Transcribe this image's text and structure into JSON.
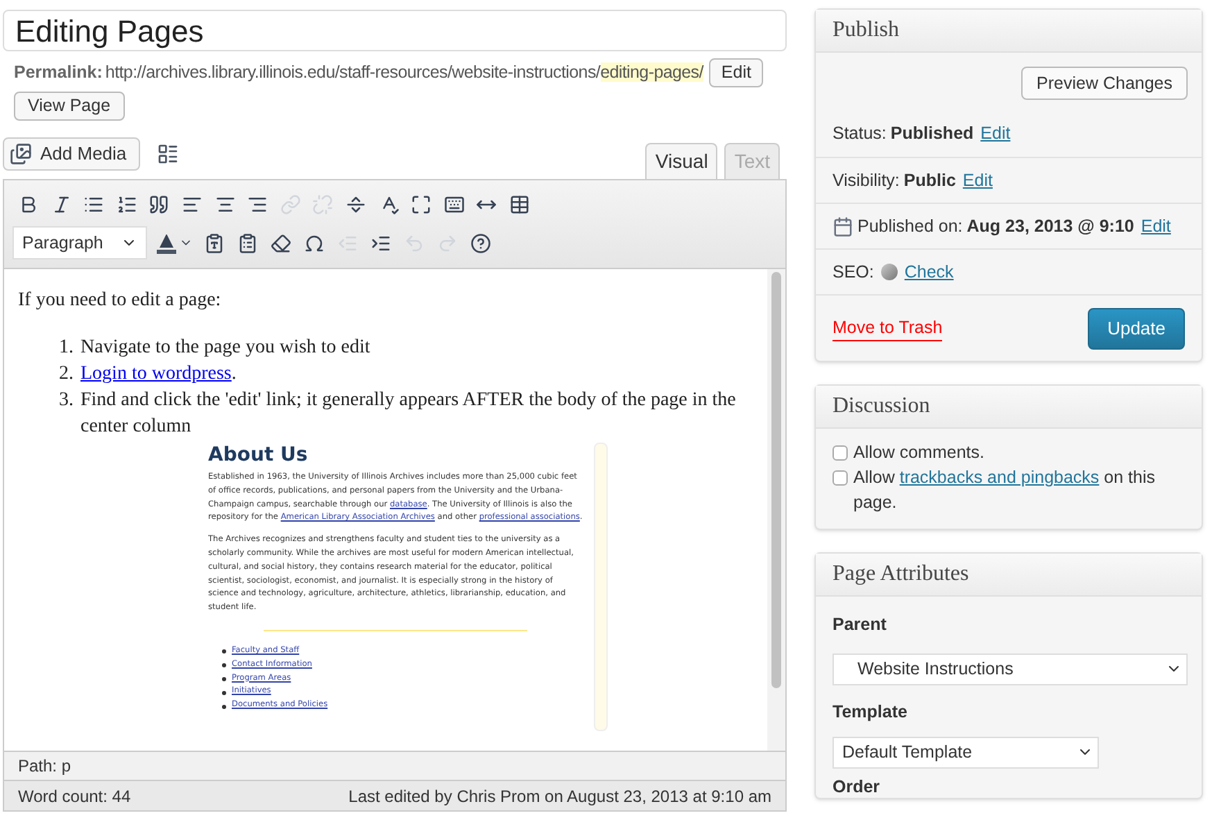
{
  "title_field": {
    "value": "Editing Pages"
  },
  "permalink": {
    "label": "Permalink:",
    "base": "http://archives.library.illinois.edu/staff-resources/website-instructions/",
    "slug": "editing-pages/",
    "edit_button": "Edit",
    "view_button": "View Page"
  },
  "media_button": "Add Media",
  "editor_tabs": [
    {
      "label": "Visual",
      "selected": true
    },
    {
      "label": "Text",
      "selected": false
    }
  ],
  "toolbar": {
    "row_1": [
      {
        "disabled": false
      },
      {
        "disabled": false
      },
      {
        "disabled": false
      },
      {
        "disabled": false
      },
      {
        "disabled": false
      },
      {
        "disabled": false
      },
      {
        "disabled": false
      },
      {
        "disabled": false
      },
      {
        "disabled": true
      },
      {
        "disabled": true
      },
      {
        "disabled": false
      },
      {
        "disabled": false
      },
      {
        "disabled": false
      },
      {
        "disabled": false
      },
      {
        "disabled": false
      },
      {
        "disabled": false
      }
    ],
    "format_select": "Paragraph",
    "row_2": [
      {
        "disabled": false
      },
      {
        "disabled": false
      },
      {
        "disabled": false
      },
      {
        "disabled": false
      },
      {
        "disabled": false
      },
      {
        "disabled": true
      },
      {
        "disabled": false
      },
      {
        "disabled": true
      },
      {
        "disabled": true
      },
      {
        "disabled": false
      }
    ]
  },
  "content": {
    "intro": "If you need to edit a page:",
    "steps": [
      {
        "number": "1.",
        "text": "Navigate to the page you wish to edit"
      },
      {
        "number": "2.",
        "link": "Login to wordpress",
        "after": "."
      },
      {
        "number": "3.",
        "text": "Find and click the 'edit' link; it generally appears AFTER the body of the page in the center column"
      }
    ],
    "screenshot": {
      "heading": "About Us",
      "paragraph_1": [
        {
          "text": "Established in 1963, the University of Illinois Archives includes more than 25,000 cubic feet of office records, publications, and personal papers from the University and the Urbana-Champaign campus, searchable through our ",
          "link": false
        },
        {
          "text": "database",
          "link": true
        },
        {
          "text": ". The University of Illinois is also the repository for the ",
          "link": false
        },
        {
          "text": "American Library Association Archives",
          "link": true
        },
        {
          "text": " and other ",
          "link": false
        },
        {
          "text": "professional associations",
          "link": true
        },
        {
          "text": ".",
          "link": false
        }
      ],
      "paragraph_2": "The Archives recognizes and strengthens faculty and student ties to the university as a scholarly community. While the archives are most useful for modern American intellectual, cultural, and social history, they contains research material for the educator, political scientist, sociologist, economist, and journalist. It is especially strong in the history of science and technology, agriculture, architecture, athletics, librarianship, education, and student life.",
      "links": [
        "Faculty and Staff",
        "Contact Information",
        "Program Areas",
        "Initiatives",
        "Documents and Policies"
      ]
    }
  },
  "path": "Path: p",
  "word_count": "Word count: 44",
  "last_edited": "Last edited by Chris Prom on August 23, 2013 at 9:10 am",
  "publish": {
    "title": "Publish",
    "preview_button": "Preview Changes",
    "rows": [
      {
        "kind": "status",
        "label": "Status:",
        "value": "Published",
        "link": "Edit"
      },
      {
        "kind": "visibility",
        "label": "Visibility:",
        "value": "Public",
        "link": "Edit"
      },
      {
        "kind": "date",
        "label": "Published on:",
        "value": "Aug 23, 2013 @ 9:10",
        "link": "Edit"
      },
      {
        "kind": "seo",
        "label": "SEO:",
        "value": "",
        "link": "Check"
      }
    ],
    "trash_link": "Move to Trash",
    "update_button": "Update"
  },
  "discussion": {
    "title": "Discussion",
    "options": [
      {
        "label": "Allow comments.",
        "checked": false
      },
      {
        "label": "Allow ",
        "link": "trackbacks and pingbacks",
        "after": " on this page.",
        "checked": false
      }
    ]
  },
  "page_attributes": {
    "title": "Page Attributes",
    "parent_label": "Parent",
    "parent_value": "Website Instructions",
    "template_label": "Template",
    "template_value": "Default Template",
    "order_label": "Order"
  }
}
